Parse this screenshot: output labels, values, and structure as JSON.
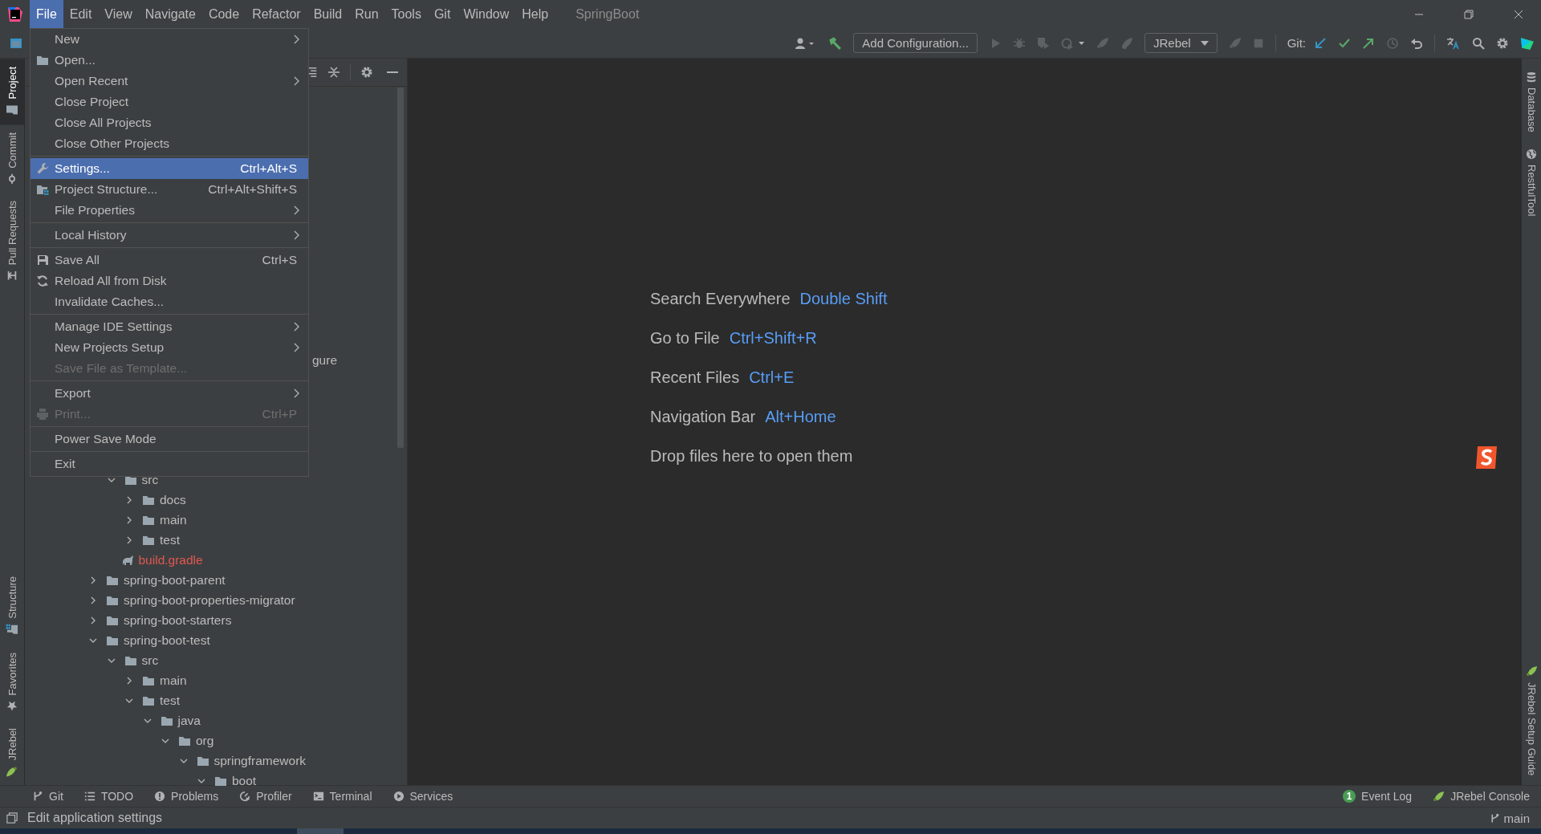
{
  "menu_bar": {
    "items": [
      {
        "label": "File",
        "selected": true
      },
      {
        "label": "Edit",
        "selected": false
      },
      {
        "label": "View",
        "selected": false
      },
      {
        "label": "Navigate",
        "selected": false
      },
      {
        "label": "Code",
        "selected": false
      },
      {
        "label": "Refactor",
        "selected": false
      },
      {
        "label": "Build",
        "selected": false
      },
      {
        "label": "Run",
        "selected": false
      },
      {
        "label": "Tools",
        "selected": false
      },
      {
        "label": "Git",
        "selected": false
      },
      {
        "label": "Window",
        "selected": false
      },
      {
        "label": "Help",
        "selected": false
      }
    ],
    "project_title": "SpringBoot"
  },
  "toolbar": {
    "add_configuration": "Add Configuration...",
    "run_target": "JRebel",
    "git_label": "Git:"
  },
  "left_tool_strip": {
    "top": [
      {
        "label": "Project",
        "kind": "project",
        "selected": true
      },
      {
        "label": "Commit",
        "kind": "commit",
        "selected": false
      },
      {
        "label": "Pull Requests",
        "kind": "pull",
        "selected": false
      }
    ],
    "bottom": [
      {
        "label": "Structure",
        "kind": "structure",
        "selected": false
      },
      {
        "label": "Favorites",
        "kind": "favorites",
        "selected": false
      },
      {
        "label": "JRebel",
        "kind": "jrebel",
        "selected": false
      }
    ]
  },
  "right_tool_strip": {
    "top": [
      {
        "label": "Database",
        "kind": "database"
      },
      {
        "label": "RestfulTool",
        "kind": "restful"
      }
    ],
    "bottom": [
      {
        "label": "JRebel Setup Guide",
        "kind": "jrebel"
      }
    ]
  },
  "file_menu": {
    "items": [
      {
        "kind": "item",
        "label": "New",
        "submenu": true,
        "disabled": false,
        "selected": false
      },
      {
        "kind": "item",
        "label": "Open...",
        "submenu": false,
        "disabled": false,
        "selected": false
      },
      {
        "kind": "item",
        "label": "Open Recent",
        "submenu": true,
        "disabled": false,
        "selected": false
      },
      {
        "kind": "item",
        "label": "Close Project",
        "submenu": false,
        "disabled": false,
        "selected": false
      },
      {
        "kind": "item",
        "label": "Close All Projects",
        "submenu": false,
        "disabled": false,
        "selected": false
      },
      {
        "kind": "item",
        "label": "Close Other Projects",
        "submenu": false,
        "disabled": false,
        "selected": false
      },
      {
        "kind": "separator"
      },
      {
        "kind": "item",
        "label": "Settings...",
        "shortcut": "Ctrl+Alt+S",
        "submenu": false,
        "disabled": false,
        "selected": true
      },
      {
        "kind": "item",
        "label": "Project Structure...",
        "shortcut": "Ctrl+Alt+Shift+S",
        "submenu": false,
        "disabled": false,
        "selected": false
      },
      {
        "kind": "item",
        "label": "File Properties",
        "submenu": true,
        "disabled": false,
        "selected": false
      },
      {
        "kind": "separator"
      },
      {
        "kind": "item",
        "label": "Local History",
        "submenu": true,
        "disabled": false,
        "selected": false
      },
      {
        "kind": "separator"
      },
      {
        "kind": "item",
        "label": "Save All",
        "shortcut": "Ctrl+S",
        "submenu": false,
        "disabled": false,
        "selected": false
      },
      {
        "kind": "item",
        "label": "Reload All from Disk",
        "submenu": false,
        "disabled": false,
        "selected": false
      },
      {
        "kind": "item",
        "label": "Invalidate Caches...",
        "submenu": false,
        "disabled": false,
        "selected": false
      },
      {
        "kind": "separator"
      },
      {
        "kind": "item",
        "label": "Manage IDE Settings",
        "submenu": true,
        "disabled": false,
        "selected": false
      },
      {
        "kind": "item",
        "label": "New Projects Setup",
        "submenu": true,
        "disabled": false,
        "selected": false
      },
      {
        "kind": "item",
        "label": "Save File as Template...",
        "submenu": false,
        "disabled": true,
        "selected": false
      },
      {
        "kind": "separator"
      },
      {
        "kind": "item",
        "label": "Export",
        "submenu": true,
        "disabled": false,
        "selected": false
      },
      {
        "kind": "item",
        "label": "Print...",
        "shortcut": "Ctrl+P",
        "submenu": false,
        "disabled": true,
        "selected": false
      },
      {
        "kind": "separator"
      },
      {
        "kind": "item",
        "label": "Power Save Mode",
        "submenu": false,
        "disabled": false,
        "selected": false
      },
      {
        "kind": "separator"
      },
      {
        "kind": "item",
        "label": "Exit",
        "submenu": false,
        "disabled": false,
        "selected": false
      }
    ]
  },
  "project_tree": {
    "covered_fragment": "gure",
    "continued": [
      {
        "label": "src",
        "kind": "folder",
        "expanded": true,
        "children": [
          {
            "label": "docs",
            "kind": "folder",
            "expanded": false
          },
          {
            "label": "main",
            "kind": "folder",
            "expanded": false
          },
          {
            "label": "test",
            "kind": "folder",
            "expanded": false
          }
        ]
      },
      {
        "label": "build.gradle",
        "kind": "gradle",
        "color": "#e0584f"
      }
    ],
    "items": [
      {
        "label": "spring-boot-parent",
        "kind": "folder",
        "expanded": false
      },
      {
        "label": "spring-boot-properties-migrator",
        "kind": "folder",
        "expanded": false
      },
      {
        "label": "spring-boot-starters",
        "kind": "folder",
        "expanded": false
      },
      {
        "label": "spring-boot-test",
        "kind": "folder",
        "expanded": true,
        "children": [
          {
            "label": "src",
            "kind": "folder",
            "expanded": true,
            "children": [
              {
                "label": "main",
                "kind": "folder",
                "expanded": false
              },
              {
                "label": "test",
                "kind": "folder",
                "expanded": true,
                "children": [
                  {
                    "label": "java",
                    "kind": "folder",
                    "expanded": true,
                    "children": [
                      {
                        "label": "org",
                        "kind": "folder",
                        "expanded": true,
                        "children": [
                          {
                            "label": "springframework",
                            "kind": "folder",
                            "expanded": true,
                            "children": [
                              {
                                "label": "boot",
                                "kind": "folder",
                                "expanded": true
                              }
                            ]
                          }
                        ]
                      }
                    ]
                  }
                ]
              }
            ]
          }
        ]
      }
    ]
  },
  "editor_hints": [
    {
      "action": "Search Everywhere",
      "shortcut": "Double Shift"
    },
    {
      "action": "Go to File",
      "shortcut": "Ctrl+Shift+R"
    },
    {
      "action": "Recent Files",
      "shortcut": "Ctrl+E"
    },
    {
      "action": "Navigation Bar",
      "shortcut": "Alt+Home"
    },
    {
      "action": "Drop files here to open them"
    }
  ],
  "bottom_tool_bar": {
    "left": [
      {
        "label": "Git",
        "kind": "git"
      },
      {
        "label": "TODO",
        "kind": "todo"
      },
      {
        "label": "Problems",
        "kind": "problems"
      },
      {
        "label": "Profiler",
        "kind": "profiler"
      },
      {
        "label": "Terminal",
        "kind": "terminal"
      },
      {
        "label": "Services",
        "kind": "services"
      }
    ],
    "right": [
      {
        "label": "Event Log",
        "kind": "event_log",
        "badge": "1"
      },
      {
        "label": "JRebel Console",
        "kind": "jrebel"
      }
    ]
  },
  "status_bar": {
    "message": "Edit application settings",
    "branch": "main"
  }
}
